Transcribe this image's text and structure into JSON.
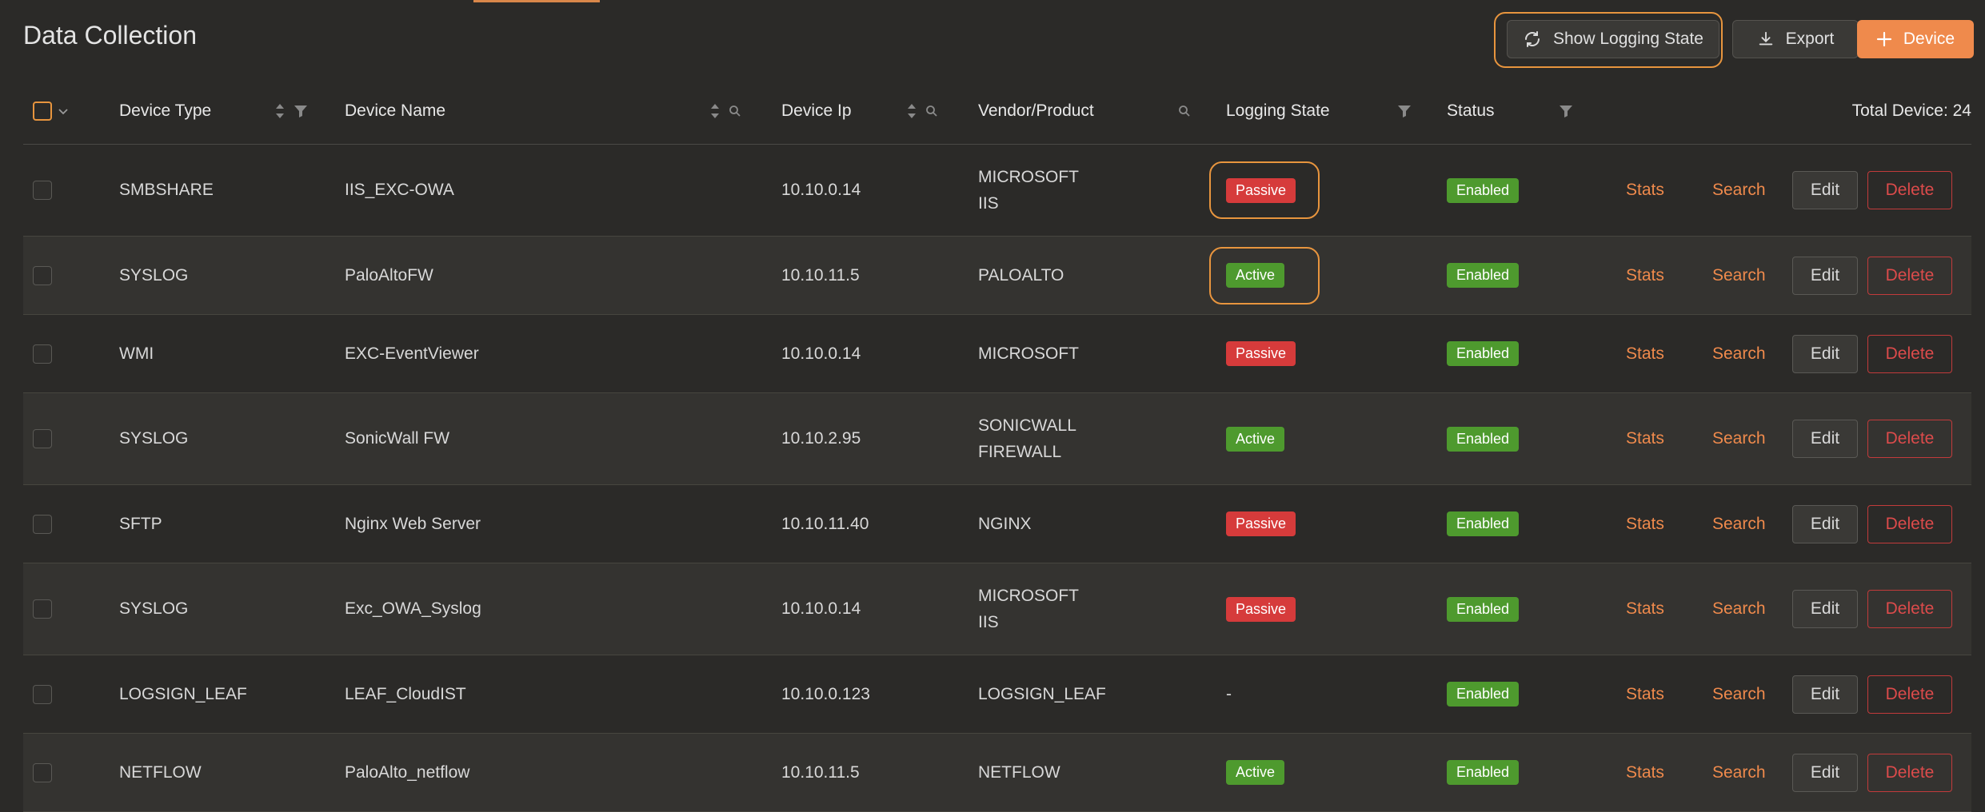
{
  "page_title": "Data Collection",
  "toolbar": {
    "show_logging_label": "Show Logging State",
    "export_label": "Export",
    "device_label": "Device"
  },
  "table": {
    "headers": {
      "device_type": "Device Type",
      "device_name": "Device Name",
      "device_ip": "Device Ip",
      "vendor_product": "Vendor/Product",
      "logging_state": "Logging State",
      "status": "Status",
      "total": "Total Device: 24"
    },
    "actions": {
      "stats": "Stats",
      "search": "Search",
      "edit": "Edit",
      "delete": "Delete"
    },
    "rows": [
      {
        "type": "SMBSHARE",
        "name": "IIS_EXC-OWA",
        "ip": "10.10.0.14",
        "vendor": [
          "MICROSOFT",
          "IIS"
        ],
        "state": "Passive",
        "status": "Enabled"
      },
      {
        "type": "SYSLOG",
        "name": "PaloAltoFW",
        "ip": "10.10.11.5",
        "vendor": [
          "PALOALTO"
        ],
        "state": "Active",
        "status": "Enabled"
      },
      {
        "type": "WMI",
        "name": "EXC-EventViewer",
        "ip": "10.10.0.14",
        "vendor": [
          "MICROSOFT"
        ],
        "state": "Passive",
        "status": "Enabled"
      },
      {
        "type": "SYSLOG",
        "name": "SonicWall FW",
        "ip": "10.10.2.95",
        "vendor": [
          "SONICWALL",
          "FIREWALL"
        ],
        "state": "Active",
        "status": "Enabled"
      },
      {
        "type": "SFTP",
        "name": "Nginx Web Server",
        "ip": "10.10.11.40",
        "vendor": [
          "NGINX"
        ],
        "state": "Passive",
        "status": "Enabled"
      },
      {
        "type": "SYSLOG",
        "name": "Exc_OWA_Syslog",
        "ip": "10.10.0.14",
        "vendor": [
          "MICROSOFT",
          "IIS"
        ],
        "state": "Passive",
        "status": "Enabled"
      },
      {
        "type": "LOGSIGN_LEAF",
        "name": "LEAF_CloudIST",
        "ip": "10.10.0.123",
        "vendor": [
          "LOGSIGN_LEAF"
        ],
        "state": "-",
        "status": "Enabled"
      },
      {
        "type": "NETFLOW",
        "name": "PaloAlto_netflow",
        "ip": "10.10.11.5",
        "vendor": [
          "NETFLOW"
        ],
        "state": "Active",
        "status": "Enabled"
      }
    ]
  },
  "colors": {
    "accent": "#ef8a4c",
    "passive": "#d63b3b",
    "active": "#4e9a2e",
    "highlight": "#e8953e"
  }
}
